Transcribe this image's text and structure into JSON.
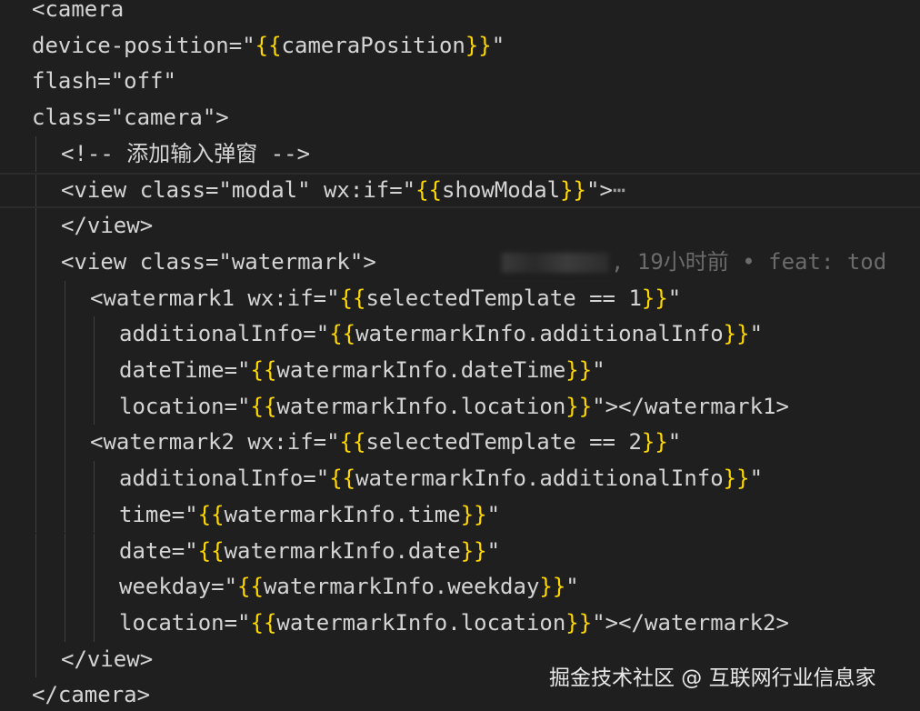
{
  "editor": {
    "lines": [
      {
        "indent": 0,
        "tokens": [
          {
            "t": "<camera",
            "c": "t"
          }
        ]
      },
      {
        "indent": 0,
        "tokens": [
          {
            "t": "device-position=\"",
            "c": "t"
          },
          {
            "t": "{{",
            "c": "b"
          },
          {
            "t": "cameraPosition",
            "c": "t"
          },
          {
            "t": "}}",
            "c": "b"
          },
          {
            "t": "\"",
            "c": "t"
          }
        ]
      },
      {
        "indent": 0,
        "tokens": [
          {
            "t": "flash=\"off\"",
            "c": "t"
          }
        ]
      },
      {
        "indent": 0,
        "tokens": [
          {
            "t": "class=\"camera\">",
            "c": "t"
          }
        ]
      },
      {
        "indent": 1,
        "tokens": [
          {
            "t": "<!-- 添加输入弹窗 -->",
            "c": "c"
          }
        ]
      },
      {
        "indent": 1,
        "current": true,
        "tokens": [
          {
            "t": "<view class=\"modal\" wx:if=\"",
            "c": "t"
          },
          {
            "t": "{{",
            "c": "b"
          },
          {
            "t": "showModal",
            "c": "t"
          },
          {
            "t": "}}",
            "c": "b"
          },
          {
            "t": "\">",
            "c": "t"
          },
          {
            "t": "⋯",
            "c": "fold"
          }
        ]
      },
      {
        "indent": 1,
        "tokens": [
          {
            "t": "</view>",
            "c": "t"
          }
        ]
      },
      {
        "indent": 1,
        "blame": true,
        "tokens": [
          {
            "t": "<view class=\"watermark\">",
            "c": "t"
          }
        ]
      },
      {
        "indent": 2,
        "tokens": [
          {
            "t": "<watermark1 wx:if=\"",
            "c": "t"
          },
          {
            "t": "{{",
            "c": "b"
          },
          {
            "t": "selectedTemplate == 1",
            "c": "t"
          },
          {
            "t": "}}",
            "c": "b"
          },
          {
            "t": "\"",
            "c": "t"
          }
        ]
      },
      {
        "indent": 3,
        "tokens": [
          {
            "t": "additionalInfo=\"",
            "c": "t"
          },
          {
            "t": "{{",
            "c": "b"
          },
          {
            "t": "watermarkInfo.additionalInfo",
            "c": "t"
          },
          {
            "t": "}}",
            "c": "b"
          },
          {
            "t": "\"",
            "c": "t"
          }
        ]
      },
      {
        "indent": 3,
        "tokens": [
          {
            "t": "dateTime=\"",
            "c": "t"
          },
          {
            "t": "{{",
            "c": "b"
          },
          {
            "t": "watermarkInfo.dateTime",
            "c": "t"
          },
          {
            "t": "}}",
            "c": "b"
          },
          {
            "t": "\"",
            "c": "t"
          }
        ]
      },
      {
        "indent": 3,
        "tokens": [
          {
            "t": "location=\"",
            "c": "t"
          },
          {
            "t": "{{",
            "c": "b"
          },
          {
            "t": "watermarkInfo.location",
            "c": "t"
          },
          {
            "t": "}}",
            "c": "b"
          },
          {
            "t": "\"></watermark1>",
            "c": "t"
          }
        ]
      },
      {
        "indent": 2,
        "tokens": [
          {
            "t": "<watermark2 wx:if=\"",
            "c": "t"
          },
          {
            "t": "{{",
            "c": "b"
          },
          {
            "t": "selectedTemplate == 2",
            "c": "t"
          },
          {
            "t": "}}",
            "c": "b"
          },
          {
            "t": "\"",
            "c": "t"
          }
        ]
      },
      {
        "indent": 3,
        "tokens": [
          {
            "t": "additionalInfo=\"",
            "c": "t"
          },
          {
            "t": "{{",
            "c": "b"
          },
          {
            "t": "watermarkInfo.additionalInfo",
            "c": "t"
          },
          {
            "t": "}}",
            "c": "b"
          },
          {
            "t": "\"",
            "c": "t"
          }
        ]
      },
      {
        "indent": 3,
        "tokens": [
          {
            "t": "time=\"",
            "c": "t"
          },
          {
            "t": "{{",
            "c": "b"
          },
          {
            "t": "watermarkInfo.time",
            "c": "t"
          },
          {
            "t": "}}",
            "c": "b"
          },
          {
            "t": "\"",
            "c": "t"
          }
        ]
      },
      {
        "indent": 3,
        "tokens": [
          {
            "t": "date=\"",
            "c": "t"
          },
          {
            "t": "{{",
            "c": "b"
          },
          {
            "t": "watermarkInfo.date",
            "c": "t"
          },
          {
            "t": "}}",
            "c": "b"
          },
          {
            "t": "\"",
            "c": "t"
          }
        ]
      },
      {
        "indent": 3,
        "tokens": [
          {
            "t": "weekday=\"",
            "c": "t"
          },
          {
            "t": "{{",
            "c": "b"
          },
          {
            "t": "watermarkInfo.weekday",
            "c": "t"
          },
          {
            "t": "}}",
            "c": "b"
          },
          {
            "t": "\"",
            "c": "t"
          }
        ]
      },
      {
        "indent": 3,
        "tokens": [
          {
            "t": "location=\"",
            "c": "t"
          },
          {
            "t": "{{",
            "c": "b"
          },
          {
            "t": "watermarkInfo.location",
            "c": "t"
          },
          {
            "t": "}}",
            "c": "b"
          },
          {
            "t": "\"></watermark2>",
            "c": "t"
          }
        ]
      },
      {
        "indent": 1,
        "tokens": [
          {
            "t": "</view>",
            "c": "t"
          }
        ]
      },
      {
        "indent": 0,
        "tokens": [
          {
            "t": "</camera>",
            "c": "t"
          }
        ]
      }
    ],
    "blame_text": ", 19小时前 • feat: tod",
    "colors": {
      "background": "#1f1f1f",
      "text": "#d4d4d4",
      "brace": "#ffd700",
      "blame": "#6b6b6b",
      "indent_guide": "#404040"
    }
  },
  "watermark": {
    "text": "掘金技术社区 @ 互联网行业信息家"
  }
}
